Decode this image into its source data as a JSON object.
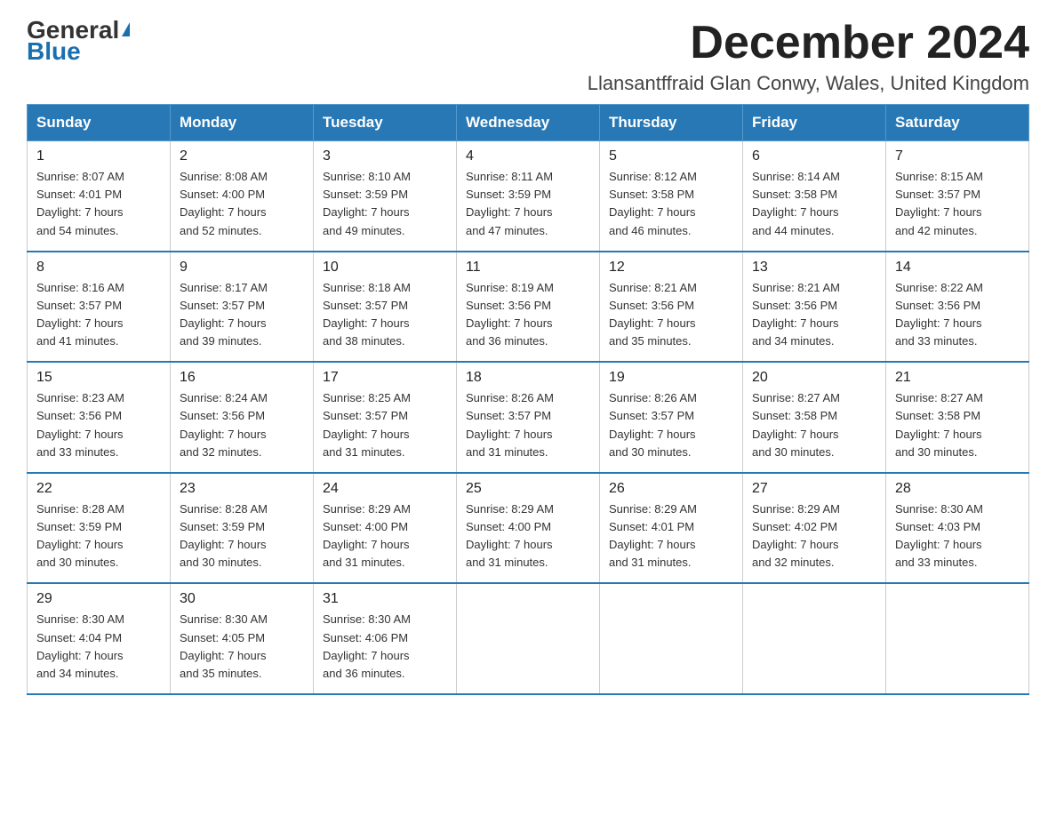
{
  "header": {
    "logo_general": "General",
    "logo_blue": "Blue",
    "month_title": "December 2024",
    "location": "Llansantffraid Glan Conwy, Wales, United Kingdom"
  },
  "weekdays": [
    "Sunday",
    "Monday",
    "Tuesday",
    "Wednesday",
    "Thursday",
    "Friday",
    "Saturday"
  ],
  "weeks": [
    [
      {
        "day": "1",
        "sunrise": "8:07 AM",
        "sunset": "4:01 PM",
        "daylight": "7 hours and 54 minutes."
      },
      {
        "day": "2",
        "sunrise": "8:08 AM",
        "sunset": "4:00 PM",
        "daylight": "7 hours and 52 minutes."
      },
      {
        "day": "3",
        "sunrise": "8:10 AM",
        "sunset": "3:59 PM",
        "daylight": "7 hours and 49 minutes."
      },
      {
        "day": "4",
        "sunrise": "8:11 AM",
        "sunset": "3:59 PM",
        "daylight": "7 hours and 47 minutes."
      },
      {
        "day": "5",
        "sunrise": "8:12 AM",
        "sunset": "3:58 PM",
        "daylight": "7 hours and 46 minutes."
      },
      {
        "day": "6",
        "sunrise": "8:14 AM",
        "sunset": "3:58 PM",
        "daylight": "7 hours and 44 minutes."
      },
      {
        "day": "7",
        "sunrise": "8:15 AM",
        "sunset": "3:57 PM",
        "daylight": "7 hours and 42 minutes."
      }
    ],
    [
      {
        "day": "8",
        "sunrise": "8:16 AM",
        "sunset": "3:57 PM",
        "daylight": "7 hours and 41 minutes."
      },
      {
        "day": "9",
        "sunrise": "8:17 AM",
        "sunset": "3:57 PM",
        "daylight": "7 hours and 39 minutes."
      },
      {
        "day": "10",
        "sunrise": "8:18 AM",
        "sunset": "3:57 PM",
        "daylight": "7 hours and 38 minutes."
      },
      {
        "day": "11",
        "sunrise": "8:19 AM",
        "sunset": "3:56 PM",
        "daylight": "7 hours and 36 minutes."
      },
      {
        "day": "12",
        "sunrise": "8:21 AM",
        "sunset": "3:56 PM",
        "daylight": "7 hours and 35 minutes."
      },
      {
        "day": "13",
        "sunrise": "8:21 AM",
        "sunset": "3:56 PM",
        "daylight": "7 hours and 34 minutes."
      },
      {
        "day": "14",
        "sunrise": "8:22 AM",
        "sunset": "3:56 PM",
        "daylight": "7 hours and 33 minutes."
      }
    ],
    [
      {
        "day": "15",
        "sunrise": "8:23 AM",
        "sunset": "3:56 PM",
        "daylight": "7 hours and 33 minutes."
      },
      {
        "day": "16",
        "sunrise": "8:24 AM",
        "sunset": "3:56 PM",
        "daylight": "7 hours and 32 minutes."
      },
      {
        "day": "17",
        "sunrise": "8:25 AM",
        "sunset": "3:57 PM",
        "daylight": "7 hours and 31 minutes."
      },
      {
        "day": "18",
        "sunrise": "8:26 AM",
        "sunset": "3:57 PM",
        "daylight": "7 hours and 31 minutes."
      },
      {
        "day": "19",
        "sunrise": "8:26 AM",
        "sunset": "3:57 PM",
        "daylight": "7 hours and 30 minutes."
      },
      {
        "day": "20",
        "sunrise": "8:27 AM",
        "sunset": "3:58 PM",
        "daylight": "7 hours and 30 minutes."
      },
      {
        "day": "21",
        "sunrise": "8:27 AM",
        "sunset": "3:58 PM",
        "daylight": "7 hours and 30 minutes."
      }
    ],
    [
      {
        "day": "22",
        "sunrise": "8:28 AM",
        "sunset": "3:59 PM",
        "daylight": "7 hours and 30 minutes."
      },
      {
        "day": "23",
        "sunrise": "8:28 AM",
        "sunset": "3:59 PM",
        "daylight": "7 hours and 30 minutes."
      },
      {
        "day": "24",
        "sunrise": "8:29 AM",
        "sunset": "4:00 PM",
        "daylight": "7 hours and 31 minutes."
      },
      {
        "day": "25",
        "sunrise": "8:29 AM",
        "sunset": "4:00 PM",
        "daylight": "7 hours and 31 minutes."
      },
      {
        "day": "26",
        "sunrise": "8:29 AM",
        "sunset": "4:01 PM",
        "daylight": "7 hours and 31 minutes."
      },
      {
        "day": "27",
        "sunrise": "8:29 AM",
        "sunset": "4:02 PM",
        "daylight": "7 hours and 32 minutes."
      },
      {
        "day": "28",
        "sunrise": "8:30 AM",
        "sunset": "4:03 PM",
        "daylight": "7 hours and 33 minutes."
      }
    ],
    [
      {
        "day": "29",
        "sunrise": "8:30 AM",
        "sunset": "4:04 PM",
        "daylight": "7 hours and 34 minutes."
      },
      {
        "day": "30",
        "sunrise": "8:30 AM",
        "sunset": "4:05 PM",
        "daylight": "7 hours and 35 minutes."
      },
      {
        "day": "31",
        "sunrise": "8:30 AM",
        "sunset": "4:06 PM",
        "daylight": "7 hours and 36 minutes."
      },
      null,
      null,
      null,
      null
    ]
  ],
  "labels": {
    "sunrise": "Sunrise:",
    "sunset": "Sunset:",
    "daylight": "Daylight:"
  }
}
